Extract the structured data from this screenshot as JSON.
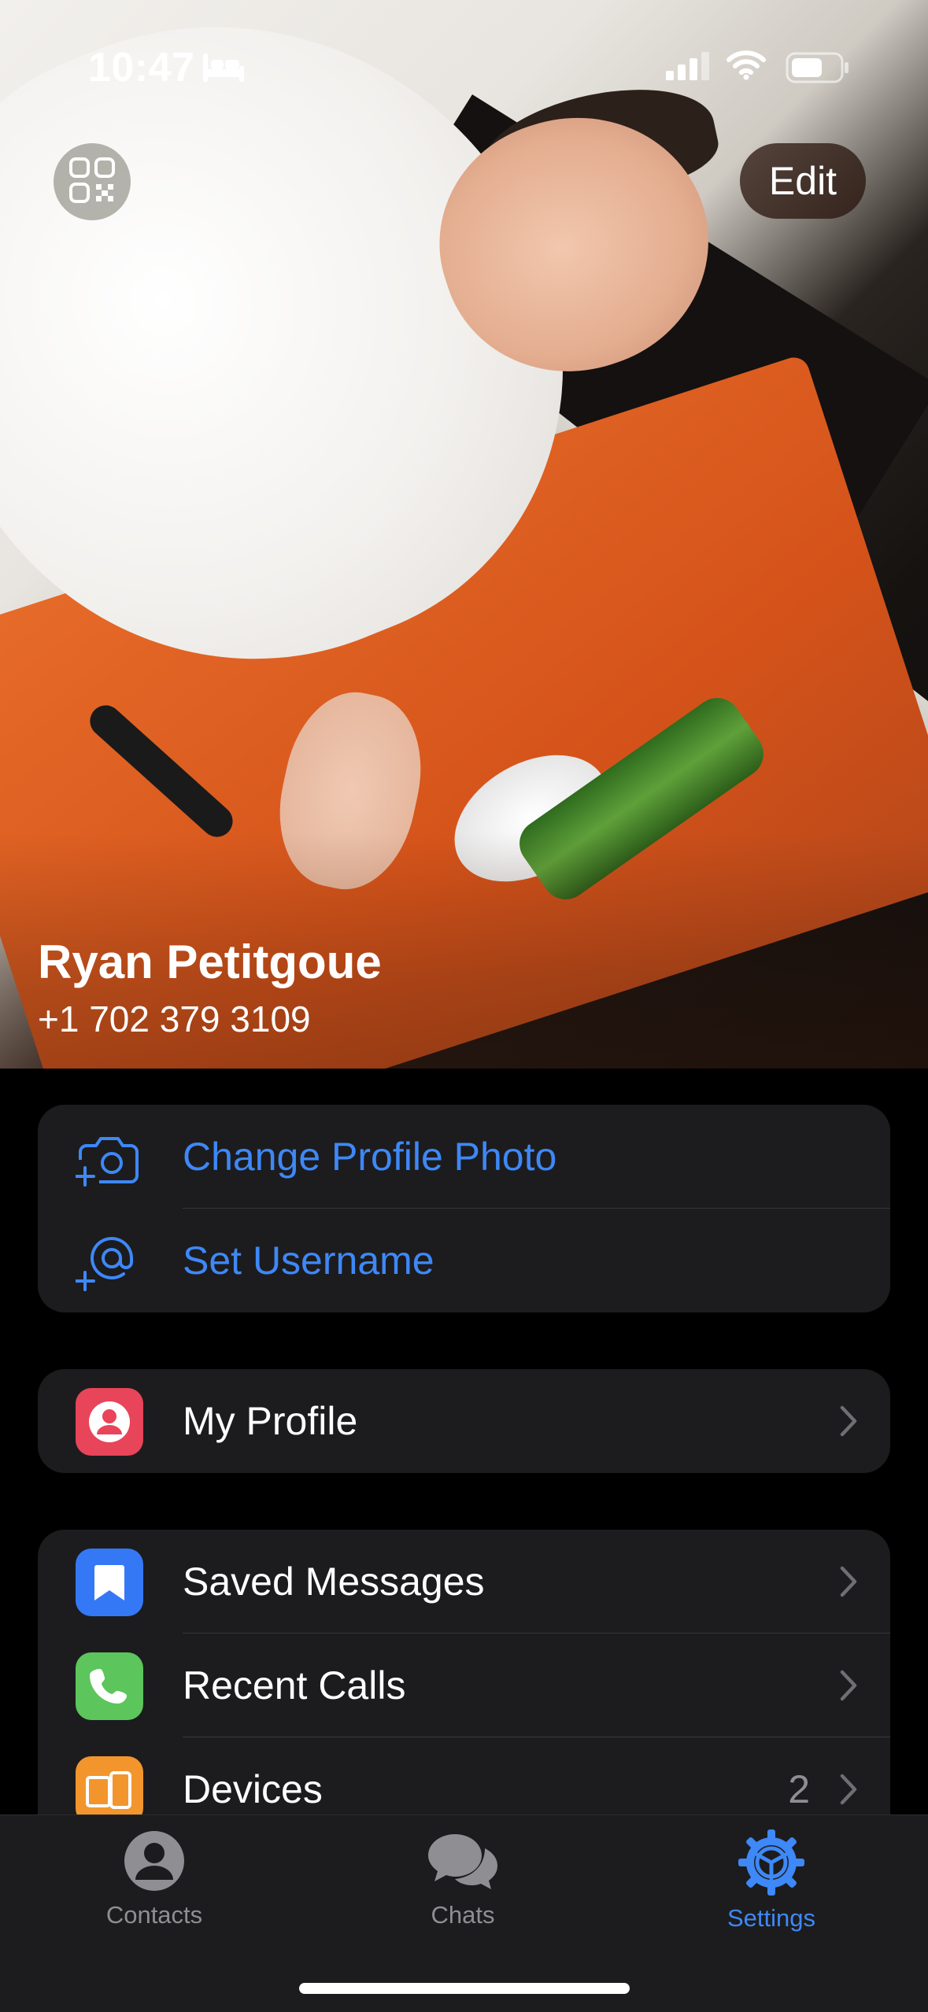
{
  "status_bar": {
    "time": "10:47",
    "icons": [
      "sleep-focus-icon",
      "cellular-signal-icon",
      "wifi-icon",
      "battery-icon"
    ]
  },
  "header": {
    "qr_icon": "qr-code-icon",
    "edit_label": "Edit",
    "name": "Ryan Petitgoue",
    "phone": "+1 702 379 3109"
  },
  "account_actions": [
    {
      "label": "Change Profile Photo",
      "icon": "camera-add-icon"
    },
    {
      "label": "Set Username",
      "icon": "at-sign-add-icon"
    }
  ],
  "profile_group": [
    {
      "label": "My Profile",
      "icon": "person-icon",
      "color": "#e8445a"
    }
  ],
  "settings_group": [
    {
      "label": "Saved Messages",
      "icon": "bookmark-icon",
      "color": "#3478f6"
    },
    {
      "label": "Recent Calls",
      "icon": "phone-icon",
      "color": "#5cc55c"
    },
    {
      "label": "Devices",
      "icon": "devices-icon",
      "color": "#f3952d",
      "badge": "2"
    }
  ],
  "tabs": [
    {
      "label": "Contacts",
      "icon": "person-circle-icon",
      "active": false
    },
    {
      "label": "Chats",
      "icon": "chat-bubbles-icon",
      "active": false
    },
    {
      "label": "Settings",
      "icon": "gear-icon",
      "active": true
    }
  ],
  "colors": {
    "accent": "#3e88f7",
    "background": "#000000",
    "cell": "#1c1c1e"
  }
}
